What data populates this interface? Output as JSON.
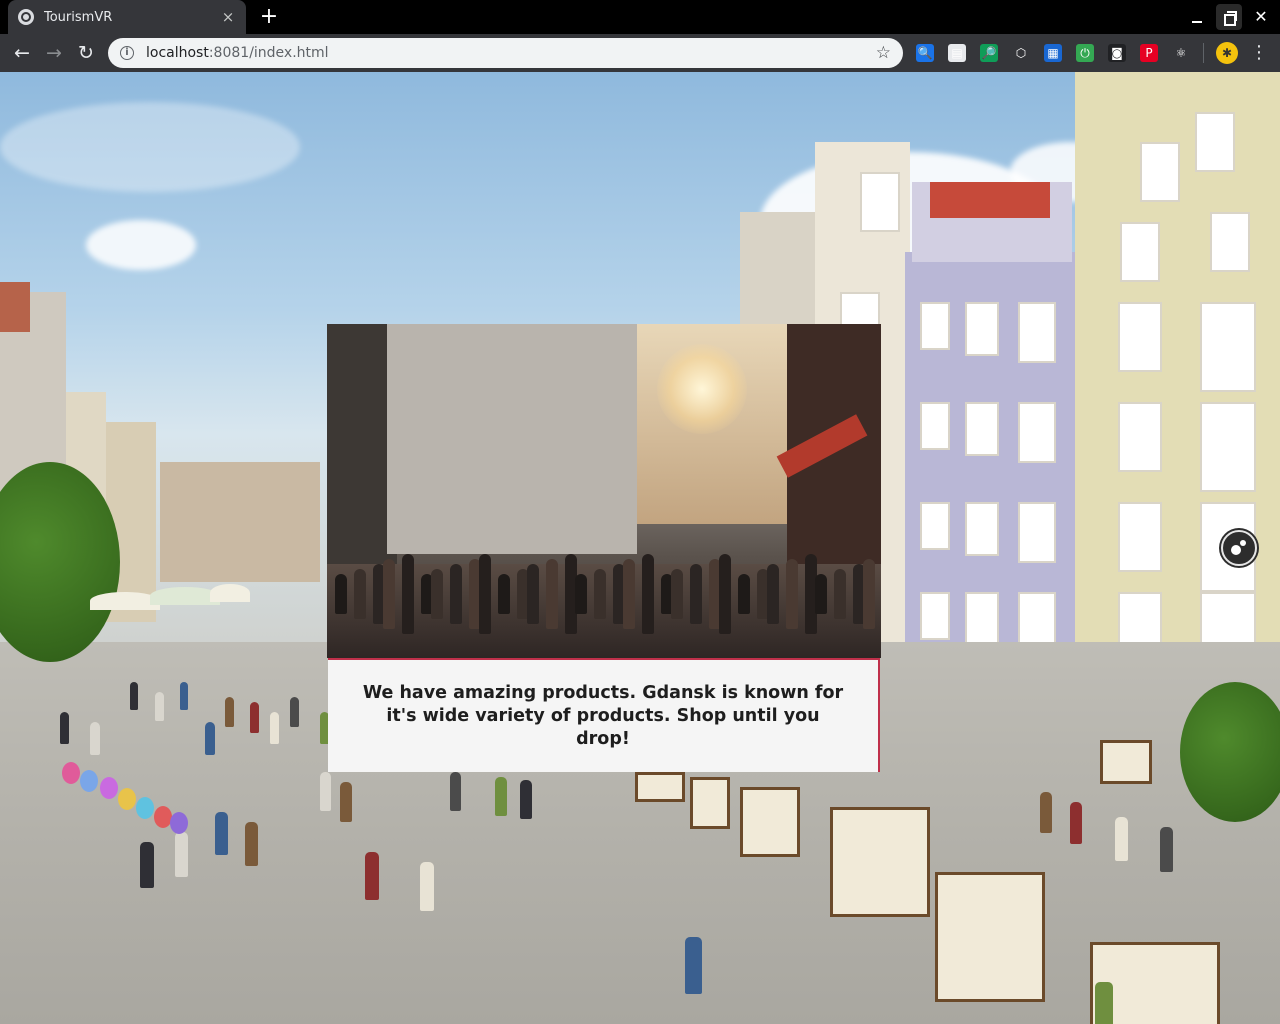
{
  "browser": {
    "tab_title": "TourismVR",
    "tab_close": "×",
    "new_tab": "+",
    "url_host": "localhost",
    "url_rest": ":8081/index.html",
    "bookmark_star": "☆",
    "info_glyph": "i",
    "back_glyph": "←",
    "forward_glyph": "→",
    "reload_glyph": "↻",
    "close_glyph": "✕",
    "menu_glyph": "⋮",
    "avatar_glyph": "✱",
    "extensions": [
      {
        "icon": "search-extension-icon",
        "glyph": "🔍",
        "color": "#1a73e8"
      },
      {
        "icon": "sheet-extension-icon",
        "glyph": "▤",
        "color": "#e8eaed"
      },
      {
        "icon": "magnifier-extension-icon",
        "glyph": "🔎",
        "color": "#0f9d58"
      },
      {
        "icon": "cube-extension-icon",
        "glyph": "⬡",
        "color": "#35363a"
      },
      {
        "icon": "clapper-extension-icon",
        "glyph": "▦",
        "color": "#1967d2"
      },
      {
        "icon": "power-extension-icon",
        "glyph": "⏻",
        "color": "#34a853"
      },
      {
        "icon": "mask-extension-icon",
        "glyph": "◙",
        "color": "#202124"
      },
      {
        "icon": "pinterest-extension-icon",
        "glyph": "P",
        "color": "#e60023"
      },
      {
        "icon": "react-extension-icon",
        "glyph": "⚛",
        "color": "#35363a"
      }
    ]
  },
  "scene": {
    "panel_text": "We have amazing products. Gdansk is known for it's wide variety of products. Shop until you drop!",
    "accent_color": "#c0304a"
  }
}
